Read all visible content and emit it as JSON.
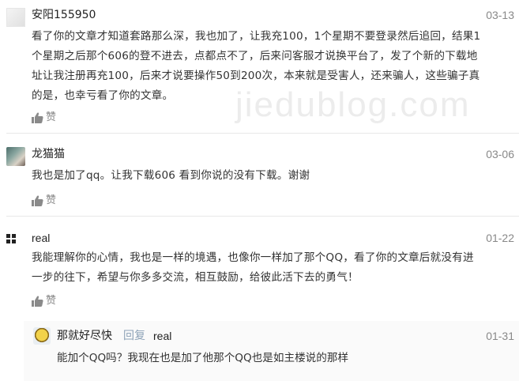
{
  "watermark": "jiedublog.com",
  "like_label": "赞",
  "comments": [
    {
      "author": "安阳155950",
      "date": "03-13",
      "lines": [
        "看了你的文章才知道套路那么深，我也加了，让我充100，1个星期不要登录然后追回，结果1",
        "个星期之后那个606的登不进去，点都点不了，后来问客服才说换平台了，发了个新的下载地",
        "址让我注册再充100，后来才说要操作50到200次，本来就是受害人，还来骗人，这些骗子真",
        "的是，也幸亏看了你的文章。"
      ]
    },
    {
      "author": "龙猫猫",
      "date": "03-06",
      "lines": [
        "我也是加了qq。让我下载606 看到你说的没有下载。谢谢"
      ]
    },
    {
      "author": "real",
      "date": "01-22",
      "lines": [
        "我能理解你的心情，我也是一样的境遇，也像你一样加了那个QQ，看了你的文章后就没有进",
        "一步的往下，希望与你多多交流，相互鼓励，给彼此活下去的勇气！"
      ]
    }
  ],
  "reply": {
    "author": "那就好尽快",
    "reply_word": "回复",
    "target": "real",
    "date": "01-31",
    "text": "能加个QQ吗？我现在也是加了他那个QQ也是如主楼说的那样"
  }
}
